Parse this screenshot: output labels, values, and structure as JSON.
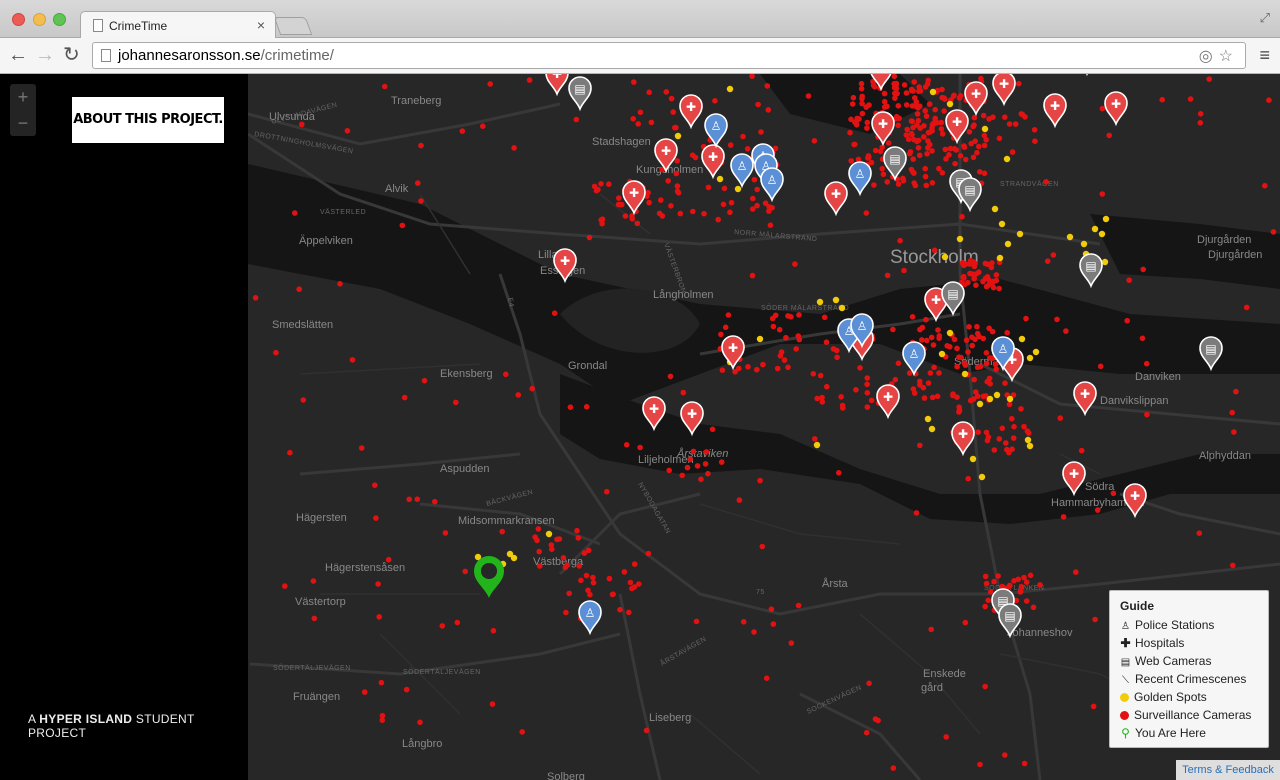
{
  "browser": {
    "tab_title": "CrimeTime",
    "url_host": "johannesaronsson.se",
    "url_path": "/crimetime/"
  },
  "sidebar": {
    "about_label": "ABOUT THIS PROJECT.",
    "credit_prefix": "A",
    "credit_brand": "HYPER ISLAND",
    "credit_suffix": "STUDENT PROJECT",
    "zoom_in": "+",
    "zoom_out": "−"
  },
  "map": {
    "place_labels": [
      "Traneberg",
      "Ulvsunda",
      "Stadshagen",
      "Kungsholmen",
      "Alvik",
      "Äppelviken",
      "Smedslätten",
      "Lilla Essingen",
      "Långholmen",
      "Ekensberg",
      "Grondal",
      "Liljeholmen",
      "Årstaviken",
      "Aspudden",
      "Midsommarkransen",
      "Hägersten",
      "Hägerstensåsen",
      "Västertorp",
      "Västberga",
      "Fruängen",
      "Långbro",
      "Liseberg",
      "Årsta",
      "Johanneshov",
      "Enskede gård",
      "Södermalm",
      "Danviken",
      "Danvikslippan",
      "Djurgården",
      "Alphyddan",
      "Södra Hammarbyhamnen",
      "Stockholm",
      "Solberg"
    ],
    "road_labels": [
      "ULVSUNDAVÄGEN",
      "DROTTNINGHOLMSVÄGEN",
      "VÄSTERLED",
      "NORR MÄLARSTRAND",
      "STRANDVÄGEN",
      "VÄSTERBRON",
      "SÖDER MÄLARSTRAND",
      "BÄCKVÄGEN",
      "SÖDERTÄLJEVÄGEN",
      "NYBODAGATAN",
      "SÖDRA LÄNKEN",
      "SOCKENVÄGEN",
      "ÅRSTAVÄGEN",
      "75",
      "E4"
    ],
    "colors": {
      "water": "#141414",
      "land": "#272727",
      "road": "#3a3a3a",
      "surveillance": "#e31212",
      "golden": "#f2cc0a",
      "police": "#5b8fd6",
      "hospital": "#e64545",
      "webcam": "#7b7b7b",
      "you_are_here": "#22b51b"
    }
  },
  "guide": {
    "title": "Guide",
    "items": [
      {
        "label": "Police Stations",
        "icon": "police-icon"
      },
      {
        "label": "Hospitals",
        "icon": "cross-icon"
      },
      {
        "label": "Web Cameras",
        "icon": "camera-icon"
      },
      {
        "label": "Recent Crimescenes",
        "icon": "knife-icon"
      },
      {
        "label": "Golden Spots",
        "icon": "yellow-dot"
      },
      {
        "label": "Surveillance Cameras",
        "icon": "red-dot"
      },
      {
        "label": "You Are Here",
        "icon": "green-pin"
      }
    ]
  },
  "attribution": "Terms & Feedback"
}
